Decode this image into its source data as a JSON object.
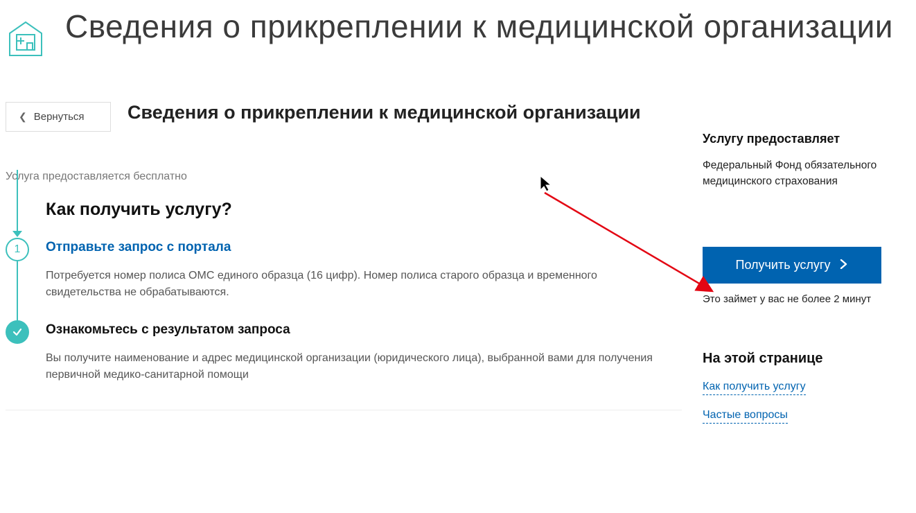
{
  "page": {
    "title": "Сведения о прикреплении к медицинской организации",
    "subtitle": "Сведения о прикреплении к медицинской организации"
  },
  "back": {
    "label": "Вернуться"
  },
  "free_note": "Услуга предоставляется бесплатно",
  "howto": {
    "title": "Как получить услугу?",
    "steps": [
      {
        "badge": "1",
        "title": "Отправьте запрос с портала",
        "desc": "Потребуется номер полиса ОМС единого образца (16 цифр). Номер полиса старого образца и временного свидетельства не обрабатываются."
      },
      {
        "badge": "✓",
        "title": "Ознакомьтесь с результатом запроса",
        "desc": "Вы получите наименование и адрес медицинской организации (юридического лица), выбранной вами для получения первичной медико-санитарной помощи"
      }
    ]
  },
  "provider": {
    "label": "Услугу предоставляет",
    "name": "Федеральный Фонд обязательного медицинского страхования"
  },
  "cta": {
    "label": "Получить услугу",
    "eta": "Это займет у вас не более 2 минут"
  },
  "onpage": {
    "title": "На этой странице",
    "links": [
      "Как получить услугу",
      "Частые вопросы"
    ]
  }
}
